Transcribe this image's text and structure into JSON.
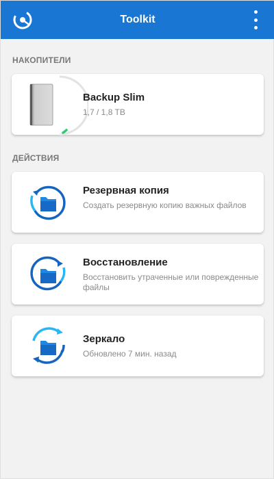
{
  "app": {
    "title": "Toolkit"
  },
  "sections": {
    "drives_title": "НАКОПИТЕЛИ",
    "actions_title": "ДЕЙСТВИЯ"
  },
  "drive": {
    "name": "Backup Slim",
    "capacity": "1,7 / 1,8 TB",
    "used_fraction": 0.94
  },
  "actions": [
    {
      "title": "Резервная копия",
      "desc": "Создать резервную копию важных файлов"
    },
    {
      "title": "Восстановление",
      "desc": "Восстановить утраченные или поврежденные файлы"
    },
    {
      "title": "Зеркало",
      "desc": "Обновлено 7 мин. назад"
    }
  ],
  "colors": {
    "topbar": "#1976d2",
    "icon_blue": "#1e88e5",
    "icon_dark": "#1565c0",
    "storage_green": "#2ecc71"
  }
}
